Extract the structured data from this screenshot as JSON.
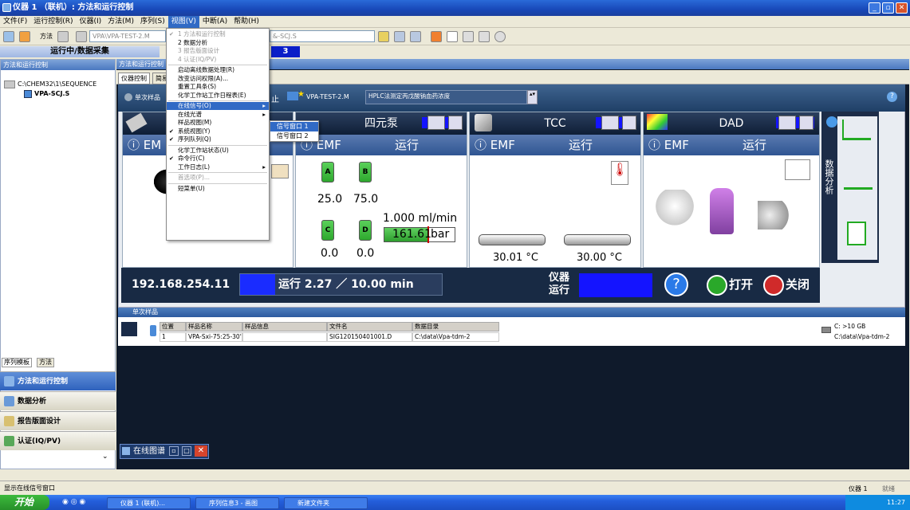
{
  "window": {
    "title": "仪器 1 （联机）: 方法和运行控制"
  },
  "menubar": [
    {
      "id": "file",
      "label": "文件(F)"
    },
    {
      "id": "run",
      "label": "运行控制(R)"
    },
    {
      "id": "instrument",
      "label": "仪器(I)"
    },
    {
      "id": "method",
      "label": "方法(M)"
    },
    {
      "id": "sequence",
      "label": "序列(S)"
    },
    {
      "id": "view",
      "label": "视图(V)"
    },
    {
      "id": "abort",
      "label": "中断(A)"
    },
    {
      "id": "help",
      "label": "帮助(H)"
    }
  ],
  "toolbar": {
    "method_label": "方法",
    "method_combo": "VPA\\VPA-TEST-2.M",
    "seq_combo": "&-SCJ.S"
  },
  "status": {
    "running": "运行中/数据采集",
    "sequence_number": "3"
  },
  "leftpane": {
    "header": "方法和运行控制",
    "tree_root": "C:\\CHEM32\\1\\SEQUENCE",
    "tree_child": "VPA-SCJ.S",
    "subtabs": [
      "序列模板",
      "方法"
    ],
    "nav": [
      "方法和运行控制",
      "数据分析",
      "报告版面设计",
      "认证(IQ/PV)"
    ]
  },
  "rightpane": {
    "header": "方法和运行控制",
    "tabs": [
      "仪器控制",
      "简易"
    ],
    "single_sample": "单次样品",
    "stop_label": "止",
    "method_file": "VPA-TEST-2.M",
    "method_desc": "HPLC法测定丙戊酸钠血药浓度"
  },
  "modules": {
    "quat_pump": {
      "title": "四元泵",
      "emf": "EMF",
      "state": "运行",
      "A": "25.0",
      "B": "75.0",
      "C": "0.0",
      "D": "0.0",
      "flow": "1.000 ml/min",
      "pressure": "161.61",
      "pressure_unit": "bar"
    },
    "tcc": {
      "title": "TCC",
      "emf": "EMF",
      "state": "运行",
      "temp_left": "30.01 °C",
      "temp_right": "30.00 °C"
    },
    "dad": {
      "title": "DAD",
      "emf": "EMF",
      "state": "运行"
    },
    "sampler": {
      "emf": "EM"
    }
  },
  "analysis_label": "数据分析",
  "infobar": {
    "ip": "192.168.254.11",
    "run_text": "运行 2.27 ／ 10.00 min",
    "instrument_status": "仪器\n运行",
    "open": "打开",
    "close": "关闭"
  },
  "sample": {
    "header": "单次样品",
    "columns": [
      "位置",
      "样品名称",
      "样品信息",
      "文件名",
      "数据目录"
    ],
    "row": [
      "1",
      "VPA-Sxi-75:25-30'",
      "",
      "SIG120150401001.D",
      "C:\\data\\Vpa-tdm-2"
    ],
    "disk_free": "C: >10 GB",
    "disk_path": "C:\\data\\Vpa-tdm-2"
  },
  "dropdown": {
    "items": [
      {
        "label": "1 方法和运行控制",
        "style": "dis chk"
      },
      {
        "label": "2 数据分析",
        "style": ""
      },
      {
        "label": "3 报告版面设计",
        "style": "dis"
      },
      {
        "label": "4 认证(IQ/PV)",
        "style": "dis"
      },
      {
        "label": "",
        "style": "sep"
      },
      {
        "label": "启动离线数据处理(R)",
        "style": ""
      },
      {
        "label": "改变访问权限(A)...",
        "style": ""
      },
      {
        "label": "重置工具条(S)",
        "style": ""
      },
      {
        "label": "化学工作站工作日程表(E)",
        "style": ""
      },
      {
        "label": "",
        "style": "sep"
      },
      {
        "label": "在线信号(O)",
        "style": "hl sub"
      },
      {
        "label": "在线光谱",
        "style": "sub"
      },
      {
        "label": "样品视图(M)",
        "style": ""
      },
      {
        "label": "系统视图(Y)",
        "style": "chk"
      },
      {
        "label": "序列队列(Q)",
        "style": "chk"
      },
      {
        "label": "",
        "style": "sep"
      },
      {
        "label": "化学工作站状态(U)",
        "style": ""
      },
      {
        "label": "命令行(C)",
        "style": "chk"
      },
      {
        "label": "工作日志(L)",
        "style": "sub"
      },
      {
        "label": "",
        "style": "sep"
      },
      {
        "label": "首选项(P)...",
        "style": "dis"
      },
      {
        "label": "",
        "style": "sep"
      },
      {
        "label": "短菜单(U)",
        "style": ""
      }
    ],
    "submenu": [
      "信号窗口 1",
      "信号窗口 2"
    ]
  },
  "minibar": "在线图谱",
  "statusbar": {
    "text": "显示在线信号窗口",
    "right": "仪器 1",
    "right2": "就绪"
  },
  "taskbar": {
    "start": "开始",
    "tasks": [
      "仪器 1 (联机)...",
      "序列信息3 - 画图",
      "新建文件夹"
    ],
    "time": "11:27"
  }
}
